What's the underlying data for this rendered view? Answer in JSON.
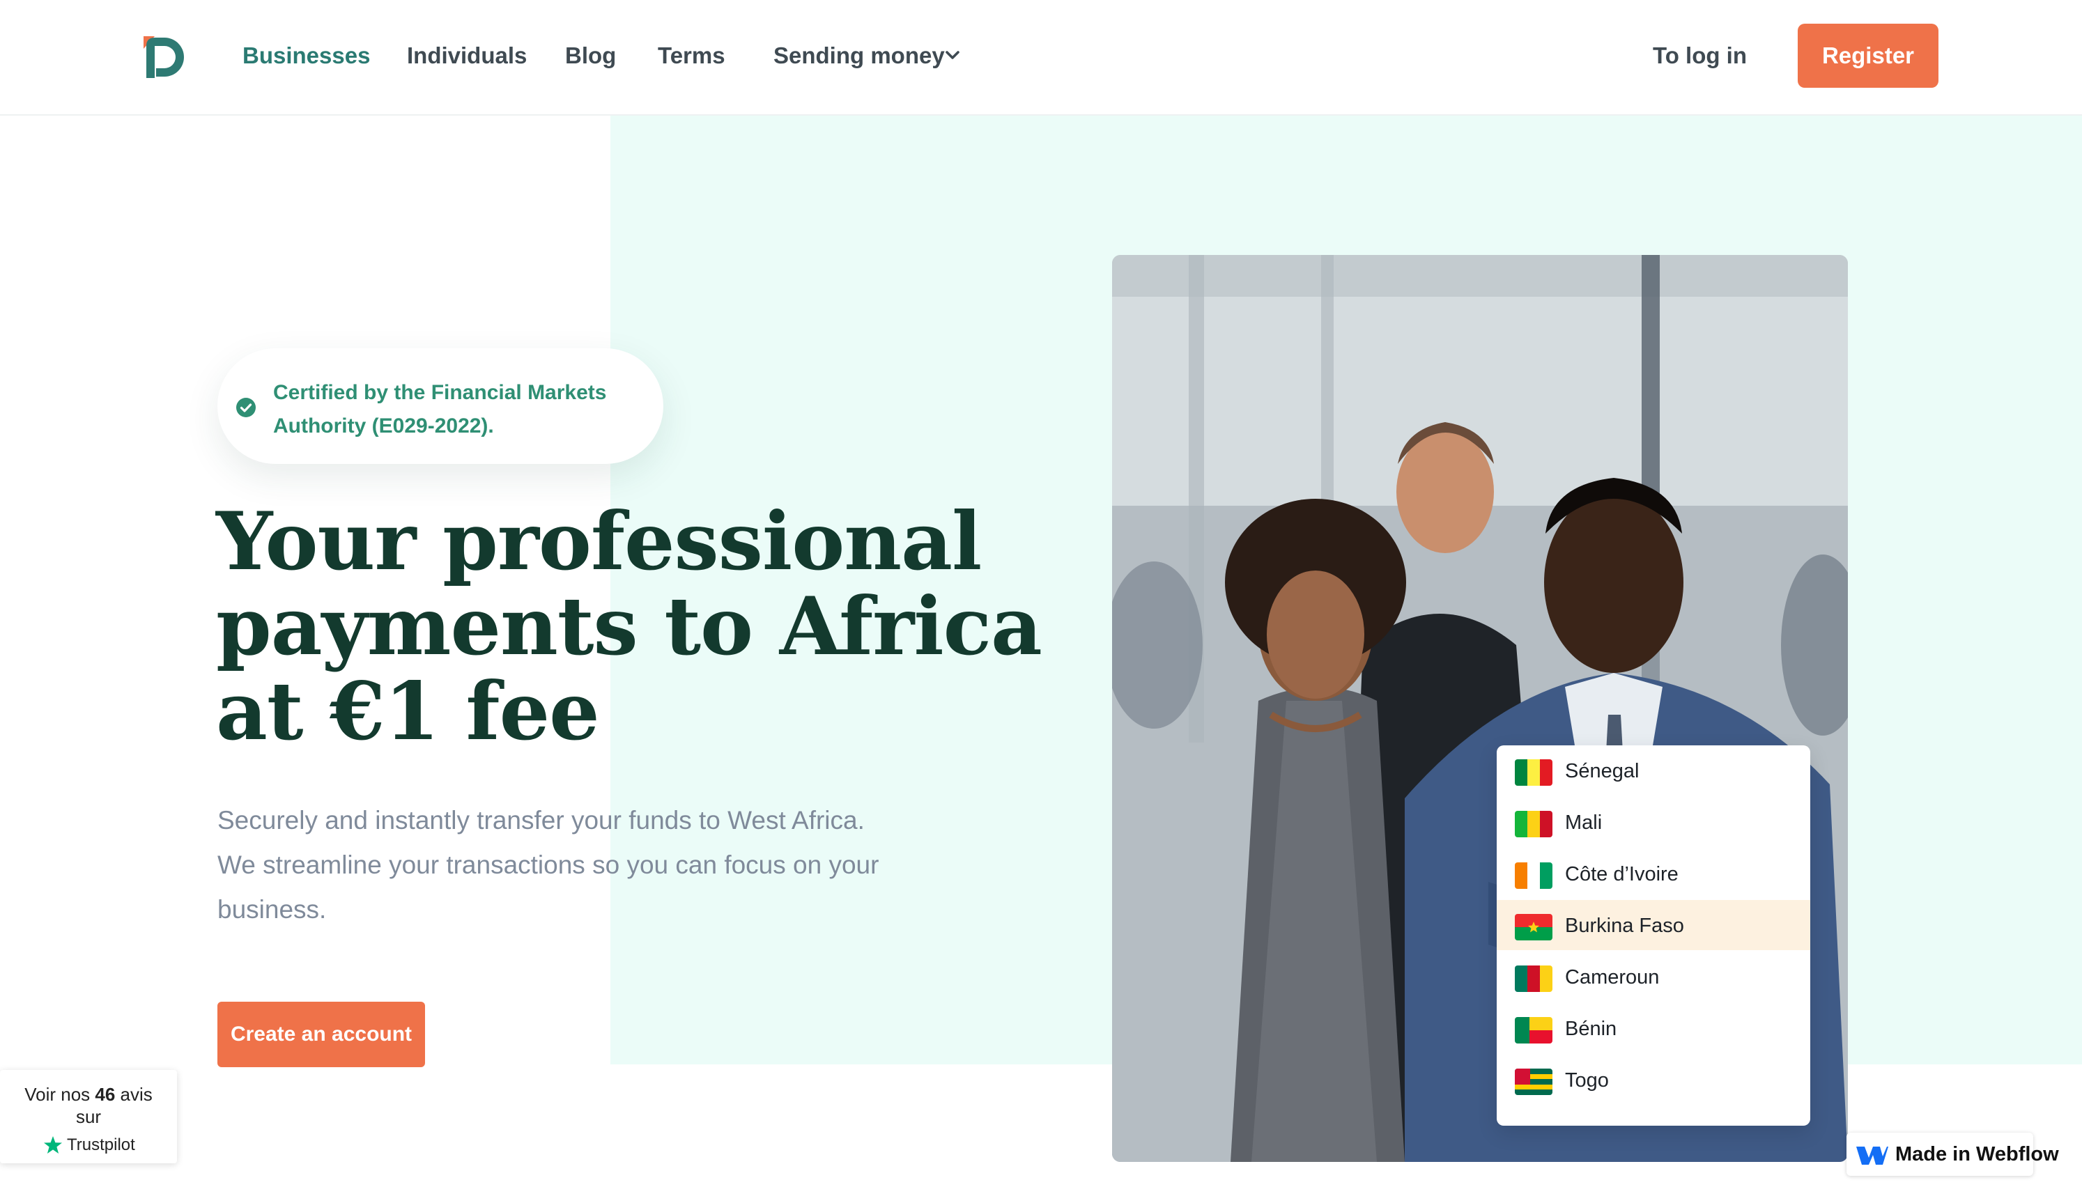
{
  "header": {
    "nav": [
      "Businesses",
      "Individuals",
      "Blog",
      "Terms",
      "Sending money"
    ],
    "login_label": "To log in",
    "register_label": "Register"
  },
  "hero": {
    "certification": "Certified by the Financial Markets Authority (E029-2022).",
    "headline": "Your professional payments to Africa at €1 fee",
    "subtext": "Securely and instantly transfer your funds to West Africa. We streamline your transactions so you can focus on your business.",
    "cta_label": "Create an account"
  },
  "countries": {
    "selected": "Burkina Faso",
    "items": [
      {
        "name": "Sénegal",
        "flag_colors": [
          "#00853f",
          "#fdef42",
          "#e31b23"
        ]
      },
      {
        "name": "Mali",
        "flag_colors": [
          "#14b53a",
          "#fcd116",
          "#ce1126"
        ]
      },
      {
        "name": "Côte d’Ivoire",
        "flag_colors": [
          "#f77f00",
          "#ffffff",
          "#009e60"
        ]
      },
      {
        "name": "Burkina Faso",
        "flag_colors": [
          "#ef2b2d",
          "#009e49"
        ]
      },
      {
        "name": "Cameroun",
        "flag_colors": [
          "#007a5e",
          "#ce1126",
          "#fcd116"
        ]
      },
      {
        "name": "Bénin",
        "flag_colors": [
          "#008751",
          "#fcd116",
          "#e8112d"
        ]
      },
      {
        "name": "Togo",
        "flag_colors": [
          "#006a4e",
          "#ffce00",
          "#d21034"
        ]
      }
    ]
  },
  "trustpilot": {
    "prefix": "Voir nos",
    "count": "46",
    "suffix": "avis",
    "line2": "sur",
    "brand": "Trustpilot"
  },
  "webflow_badge": "Made in Webflow",
  "colors": {
    "accent": "#ef7249",
    "brand_teal": "#2a7a72",
    "mint_background": "#ebfcf8",
    "headline": "#133a2e"
  }
}
